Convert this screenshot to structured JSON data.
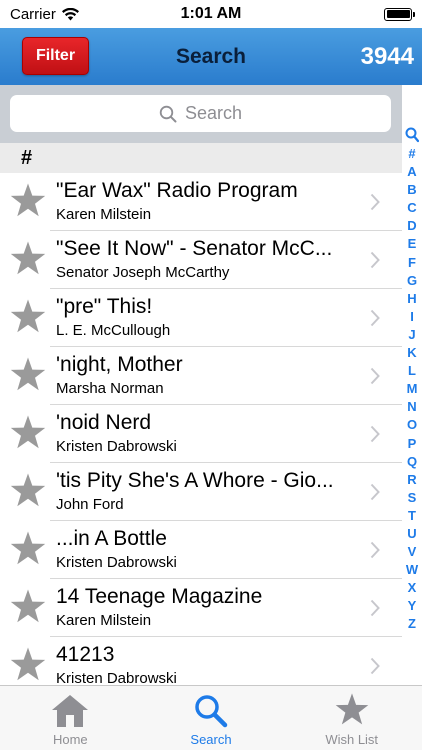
{
  "status_bar": {
    "carrier": "Carrier",
    "time": "1:01 AM"
  },
  "nav": {
    "filter_label": "Filter",
    "title": "Search",
    "count": "3944"
  },
  "search": {
    "placeholder": "Search"
  },
  "section": {
    "header": "#"
  },
  "items": [
    {
      "title": "\"Ear Wax\" Radio Program",
      "subtitle": "Karen Milstein"
    },
    {
      "title": "\"See It Now\" - Senator McC...",
      "subtitle": "Senator Joseph McCarthy"
    },
    {
      "title": "\"pre\" This!",
      "subtitle": "L. E. McCullough"
    },
    {
      "title": "'night, Mother",
      "subtitle": "Marsha Norman"
    },
    {
      "title": "'noid Nerd",
      "subtitle": "Kristen Dabrowski"
    },
    {
      "title": "'tis Pity She's A Whore - Gio...",
      "subtitle": "John Ford"
    },
    {
      "title": "...in A Bottle",
      "subtitle": "Kristen Dabrowski"
    },
    {
      "title": "14 Teenage Magazine",
      "subtitle": "Karen Milstein"
    },
    {
      "title": "41213",
      "subtitle": "Kristen Dabrowski"
    }
  ],
  "index": [
    "#",
    "A",
    "B",
    "C",
    "D",
    "E",
    "F",
    "G",
    "H",
    "I",
    "J",
    "K",
    "L",
    "M",
    "N",
    "O",
    "P",
    "Q",
    "R",
    "S",
    "T",
    "U",
    "V",
    "W",
    "X",
    "Y",
    "Z"
  ],
  "tabs": [
    {
      "label": "Home",
      "icon": "home-icon",
      "active": false
    },
    {
      "label": "Search",
      "icon": "search-icon",
      "active": true
    },
    {
      "label": "Wish List",
      "icon": "star-icon",
      "active": false
    }
  ],
  "colors": {
    "nav_bar": "#2a7ccd",
    "filter_button": "#d9191d",
    "accent": "#1e7be8",
    "star": "#9a9a9a",
    "inactive_tab": "#8e8e93"
  }
}
